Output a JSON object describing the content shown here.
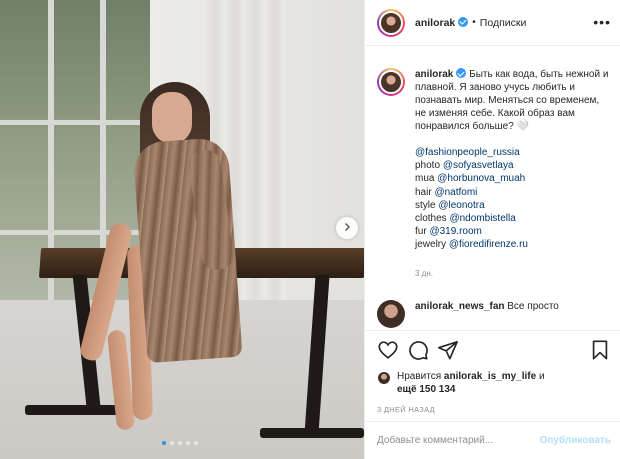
{
  "header": {
    "username": "anilorak",
    "separator": "•",
    "follow_label": "Подписки",
    "more_label": "•••"
  },
  "caption": {
    "username": "anilorak",
    "text": "Быть как вода, быть нежной и плавной. Я заново учусь любить и познавать мир. Меняться со временем, не изменяя себе. Какой образ вам понравился больше? 🤍",
    "credits": [
      {
        "prefix": "",
        "tag": "@fashionpeople_russia"
      },
      {
        "prefix": "photo ",
        "tag": "@sofyasvetlaya"
      },
      {
        "prefix": "mua ",
        "tag": "@horbunova_muah"
      },
      {
        "prefix": "hair ",
        "tag": "@natfomi"
      },
      {
        "prefix": "style ",
        "tag": "@leonotra"
      },
      {
        "prefix": "clothes ",
        "tag": "@ndombistella"
      },
      {
        "prefix": "fur ",
        "tag": "@319.room"
      },
      {
        "prefix": "jewelry ",
        "tag": "@fioredifirenze.ru"
      }
    ],
    "time": "3 дн."
  },
  "reply": {
    "username": "anilorak_news_fan",
    "text": "Все просто"
  },
  "likes": {
    "prefix": "Нравится ",
    "user": "anilorak_is_my_life",
    "joiner": " и",
    "rest": "ещё 150 134"
  },
  "post_time": "3 ДНЕЙ НАЗАД",
  "comment_box": {
    "placeholder": "Добавьте комментарий...",
    "publish_label": "Опубликовать"
  },
  "carousel": {
    "total": 5,
    "active_index": 0
  },
  "colors": {
    "verified": "#3897f0",
    "link": "#00376b",
    "muted": "#8e8e8e",
    "publish_disabled": "#b2dffc",
    "carousel_active_dot": "#2f8fea"
  },
  "icons": [
    "heart-icon",
    "comment-icon",
    "share-icon",
    "bookmark-icon",
    "chevron-right-icon",
    "verified-icon",
    "more-icon"
  ]
}
